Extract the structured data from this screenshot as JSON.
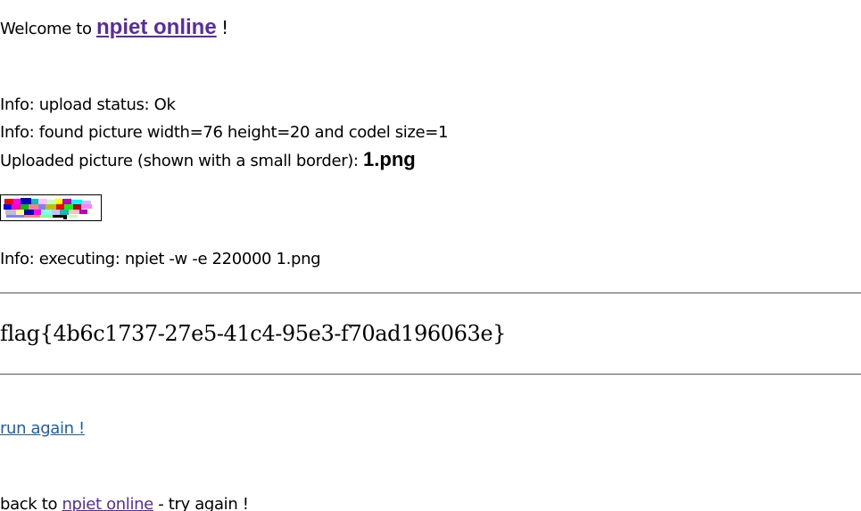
{
  "welcome": {
    "prefix": "Welcome to",
    "link_text": "npiet online",
    "suffix": "!"
  },
  "info": {
    "status": "Info: upload status: Ok",
    "picture": "Info: found picture width=76 height=20 and codel size=1",
    "uploaded_label": "Uploaded picture (shown with a small border):",
    "uploaded_filename": "1.png",
    "executing": "Info: executing: npiet -w -e 220000 1.png"
  },
  "output": {
    "flag": "flag{4b6c1737-27e5-41c4-95e3-f70ad196063e}"
  },
  "links": {
    "run_again": "run again !",
    "back_prefix": "back to",
    "back_link": "npiet online",
    "back_suffix": "- try again !"
  },
  "colors": {
    "visited_link": "#5a2ca0",
    "link": "#1a5fb4"
  }
}
